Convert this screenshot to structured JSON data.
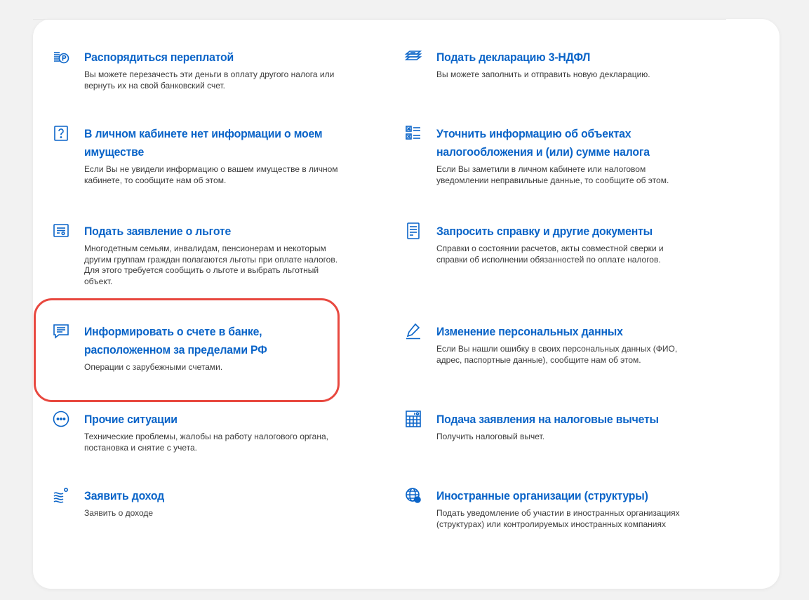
{
  "colors": {
    "accent": "#0a64c8",
    "text": "#3b3b3b",
    "highlight": "#e8483f"
  },
  "items": [
    {
      "id": "overpayment",
      "icon": "coins-ruble-icon",
      "title": [
        "Распорядиться переплатой"
      ],
      "desc": "Вы можете перезачесть эти деньги в оплату другого налога или вернуть их на свой банковский счет."
    },
    {
      "id": "declaration",
      "icon": "money-bills-icon",
      "title": [
        "Подать декларацию 3-НДФЛ"
      ],
      "desc": "Вы можете заполнить и отправить новую декларацию."
    },
    {
      "id": "no-property-info",
      "icon": "question-box-icon",
      "title": [
        "В личном кабинете нет информации о моем",
        "имуществе"
      ],
      "desc": "Если Вы не увидели информацию о вашем имуществе в личном кабинете, то сообщите нам об этом."
    },
    {
      "id": "clarify-objects",
      "icon": "checklist-icon",
      "title": [
        "Уточнить информацию об объектах",
        "налогообложения и (или) сумме налога"
      ],
      "desc": "Если Вы заметили в личном кабинете или налоговом уведомлении неправильные данные, то сообщите об этом."
    },
    {
      "id": "benefit-application",
      "icon": "certificate-icon",
      "title": [
        "Подать заявление о льготе"
      ],
      "desc": "Многодетным семьям, инвалидам, пенсионерам и некоторым другим группам граждан полагаются льготы при оплате налогов. Для этого требуется сообщить о льготе и выбрать льготный объект."
    },
    {
      "id": "request-certificate",
      "icon": "document-list-icon",
      "title": [
        "Запросить справку и другие документы"
      ],
      "desc": "Справки о состоянии расчетов, акты совместной сверки и справки об исполнении обязанностей по оплате налогов."
    },
    {
      "id": "foreign-bank-account",
      "icon": "chat-message-icon",
      "title": [
        "Информировать о счете в банке,",
        "расположенном за пределами РФ"
      ],
      "desc": "Операции с зарубежными счетами."
    },
    {
      "id": "personal-data-change",
      "icon": "pencil-icon",
      "title": [
        "Изменение персональных данных"
      ],
      "desc": "Если Вы нашли ошибку в своих персональных данных (ФИО, адрес, паспортные данные), сообщите нам об этом."
    },
    {
      "id": "other-situations",
      "icon": "more-dots-icon",
      "title": [
        "Прочие ситуации"
      ],
      "desc": "Технические проблемы, жалобы на работу налогового органа, постановка и снятие с учета."
    },
    {
      "id": "tax-deductions",
      "icon": "calculator-icon",
      "title": [
        "Подача заявления на налоговые вычеты"
      ],
      "desc": "Получить налоговый вычет."
    },
    {
      "id": "declare-income",
      "icon": "income-flow-icon",
      "title": [
        "Заявить доход"
      ],
      "desc": "Заявить о доходе"
    },
    {
      "id": "foreign-organizations",
      "icon": "globe-icon",
      "title": [
        "Иностранные организации (структуры)"
      ],
      "desc": "Подать уведомление об участии в иностранных организациях (структурах) или контролируемых иностранных компаниях"
    }
  ]
}
